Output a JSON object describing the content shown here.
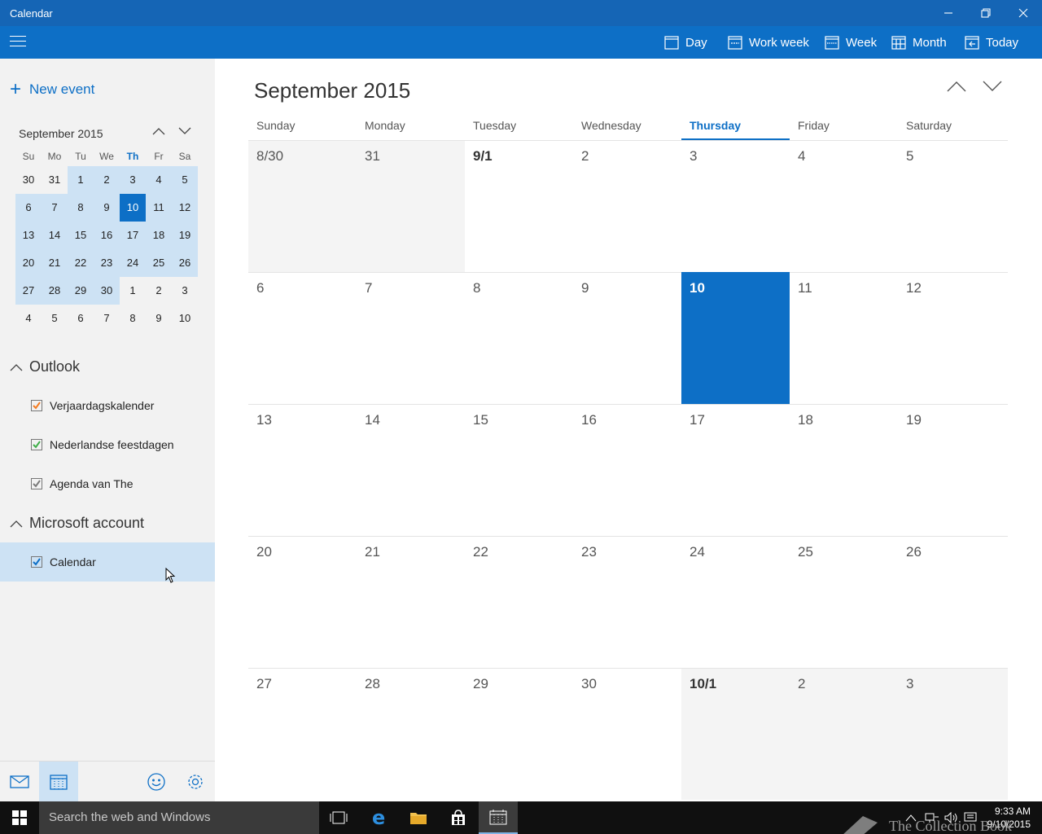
{
  "app": {
    "title": "Calendar"
  },
  "toolbar": {
    "views": [
      {
        "label": "Day",
        "icon": "day-calendar-icon"
      },
      {
        "label": "Work week",
        "icon": "work-week-calendar-icon"
      },
      {
        "label": "Week",
        "icon": "week-calendar-icon"
      },
      {
        "label": "Month",
        "icon": "month-calendar-icon"
      },
      {
        "label": "Today",
        "icon": "today-arrow-icon"
      }
    ]
  },
  "sidebar": {
    "new_event_label": "New event",
    "mini_calendar": {
      "title": "September 2015",
      "weekdays": [
        "Su",
        "Mo",
        "Tu",
        "We",
        "Th",
        "Fr",
        "Sa"
      ],
      "weeks": [
        [
          "30",
          "31",
          "1",
          "2",
          "3",
          "4",
          "5"
        ],
        [
          "6",
          "7",
          "8",
          "9",
          "10",
          "11",
          "12"
        ],
        [
          "13",
          "14",
          "15",
          "16",
          "17",
          "18",
          "19"
        ],
        [
          "20",
          "21",
          "22",
          "23",
          "24",
          "25",
          "26"
        ],
        [
          "27",
          "28",
          "29",
          "30",
          "1",
          "2",
          "3"
        ],
        [
          "4",
          "5",
          "6",
          "7",
          "8",
          "9",
          "10"
        ]
      ]
    },
    "groups": [
      {
        "name": "Outlook",
        "calendars": [
          {
            "name": "Verjaardagskalender",
            "color": "#f47b20",
            "checked": true
          },
          {
            "name": "Nederlandse feestdagen",
            "color": "#3fae49",
            "checked": true
          },
          {
            "name": "Agenda van The",
            "color": "#7a7a7a",
            "checked": true
          }
        ]
      },
      {
        "name": "Microsoft account",
        "calendars": [
          {
            "name": "Calendar",
            "color": "#0d6fc6",
            "checked": true
          }
        ]
      }
    ]
  },
  "main": {
    "title": "September 2015",
    "weekdays": [
      "Sunday",
      "Monday",
      "Tuesday",
      "Wednesday",
      "Thursday",
      "Friday",
      "Saturday"
    ],
    "weeks": [
      [
        "8/30",
        "31",
        "9/1",
        "2",
        "3",
        "4",
        "5"
      ],
      [
        "6",
        "7",
        "8",
        "9",
        "10",
        "11",
        "12"
      ],
      [
        "13",
        "14",
        "15",
        "16",
        "17",
        "18",
        "19"
      ],
      [
        "20",
        "21",
        "22",
        "23",
        "24",
        "25",
        "26"
      ],
      [
        "27",
        "28",
        "29",
        "30",
        "10/1",
        "2",
        "3"
      ]
    ]
  },
  "taskbar": {
    "search_placeholder": "Search the web and Windows",
    "time": "9:33 AM",
    "date": "9/10/2015",
    "watermark": "The Collection Book"
  },
  "colors": {
    "accent": "#0d6fc6",
    "titlebar": "#1565b5",
    "highlight": "#cde2f4"
  }
}
